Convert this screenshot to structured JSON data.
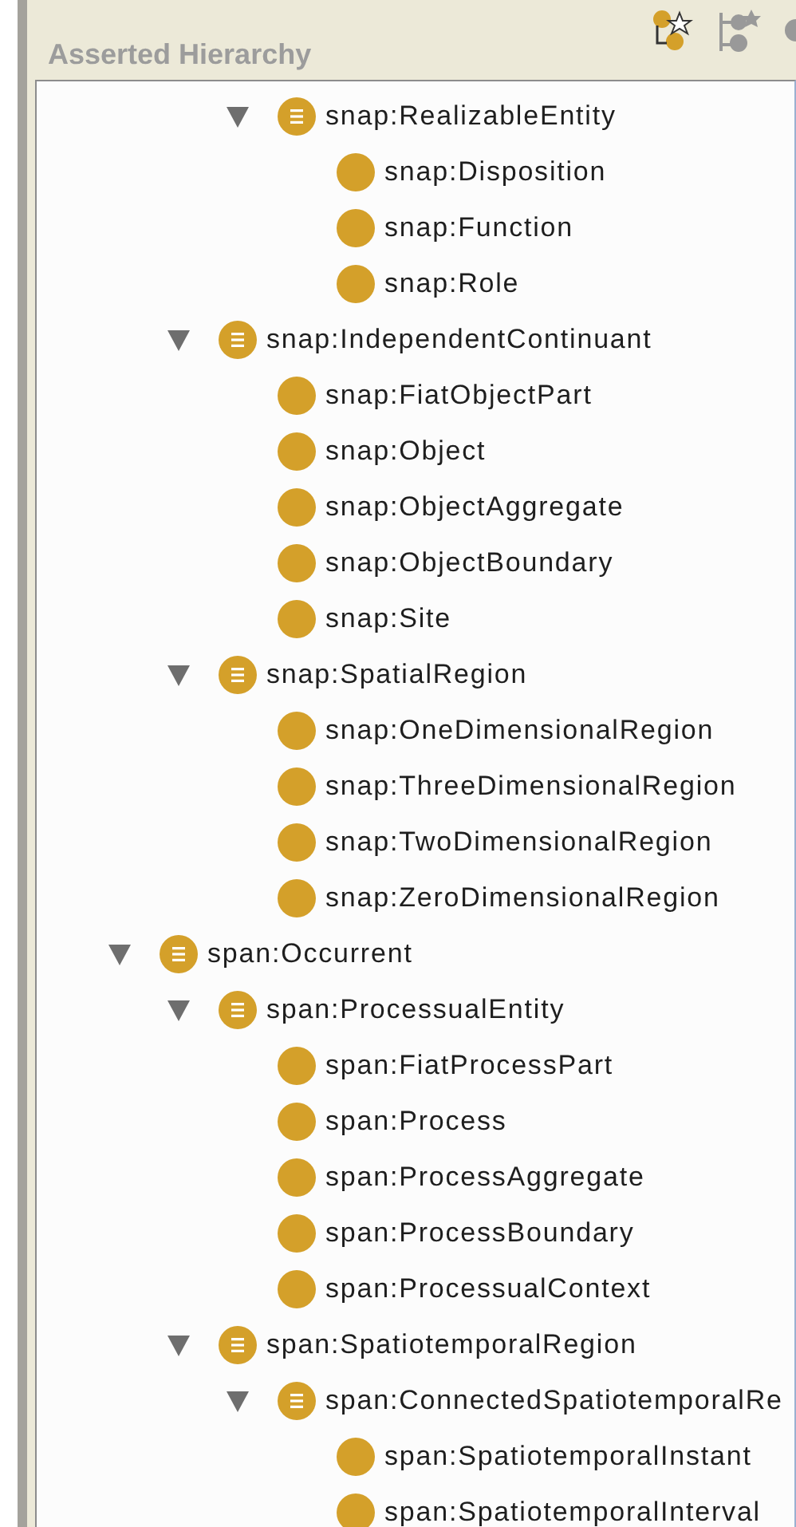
{
  "panel": {
    "title": "Asserted Hierarchy"
  },
  "tree": [
    {
      "children": [
        {
          "children": [
            {
              "label": "snap:RealizableEntity",
              "expanded": true,
              "children": [
                {
                  "label": "snap:Disposition"
                },
                {
                  "label": "snap:Function"
                },
                {
                  "label": "snap:Role"
                }
              ]
            }
          ]
        },
        {
          "label": "snap:IndependentContinuant",
          "expanded": true,
          "children": [
            {
              "label": "snap:FiatObjectPart"
            },
            {
              "label": "snap:Object"
            },
            {
              "label": "snap:ObjectAggregate"
            },
            {
              "label": "snap:ObjectBoundary"
            },
            {
              "label": "snap:Site"
            }
          ]
        },
        {
          "label": "snap:SpatialRegion",
          "expanded": true,
          "children": [
            {
              "label": "snap:OneDimensionalRegion"
            },
            {
              "label": "snap:ThreeDimensionalRegion"
            },
            {
              "label": "snap:TwoDimensionalRegion"
            },
            {
              "label": "snap:ZeroDimensionalRegion"
            }
          ]
        }
      ]
    },
    {
      "label": "span:Occurrent",
      "expanded": true,
      "children": [
        {
          "label": "span:ProcessualEntity",
          "expanded": true,
          "children": [
            {
              "label": "span:FiatProcessPart"
            },
            {
              "label": "span:Process"
            },
            {
              "label": "span:ProcessAggregate"
            },
            {
              "label": "span:ProcessBoundary"
            },
            {
              "label": "span:ProcessualContext"
            }
          ]
        },
        {
          "label": "span:SpatiotemporalRegion",
          "expanded": true,
          "children": [
            {
              "label": "span:ConnectedSpatiotemporalRe",
              "expanded": true,
              "children": [
                {
                  "label": "span:SpatiotemporalInstant"
                },
                {
                  "label": "span:SpatiotemporalInterval"
                }
              ]
            }
          ]
        }
      ]
    }
  ]
}
